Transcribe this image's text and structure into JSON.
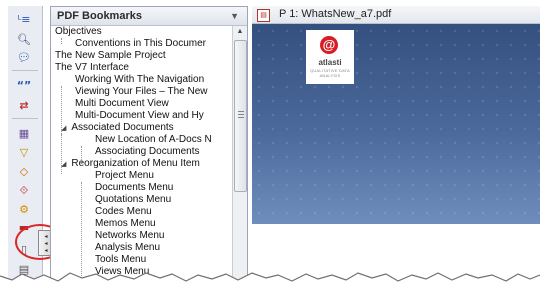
{
  "bookmarks_panel": {
    "title": "PDF Bookmarks",
    "items": [
      {
        "label": "Objectives",
        "level": 0,
        "expander": false
      },
      {
        "label": "Conventions in This Documer",
        "level": 1,
        "expander": false
      },
      {
        "label": "The New Sample Project",
        "level": 0,
        "expander": false
      },
      {
        "label": "The V7 Interface",
        "level": 0,
        "expander": false
      },
      {
        "label": "Working With The Navigation",
        "level": 1,
        "expander": false
      },
      {
        "label": "Viewing Your Files – The New",
        "level": 1,
        "expander": false
      },
      {
        "label": "Multi Document View",
        "level": 1,
        "expander": false
      },
      {
        "label": "Multi-Document View and Hy",
        "level": 1,
        "expander": false
      },
      {
        "label": "Associated Documents",
        "level": 1,
        "expander": true
      },
      {
        "label": "New Location of A-Docs N",
        "level": 2,
        "expander": false
      },
      {
        "label": "Associating Documents",
        "level": 2,
        "expander": false
      },
      {
        "label": "Reorganization of Menu Item",
        "level": 1,
        "expander": true
      },
      {
        "label": "Project Menu",
        "level": 2,
        "expander": false
      },
      {
        "label": "Documents Menu",
        "level": 2,
        "expander": false
      },
      {
        "label": "Quotations Menu",
        "level": 2,
        "expander": false
      },
      {
        "label": "Codes Menu",
        "level": 2,
        "expander": false
      },
      {
        "label": "Memos Menu",
        "level": 2,
        "expander": false
      },
      {
        "label": "Networks Menu",
        "level": 2,
        "expander": false
      },
      {
        "label": "Analysis Menu",
        "level": 2,
        "expander": false
      },
      {
        "label": "Tools Menu",
        "level": 2,
        "expander": false
      },
      {
        "label": "Views Menu",
        "level": 2,
        "expander": false
      }
    ]
  },
  "document": {
    "tab_title": "P 1: WhatsNew_a7.pdf",
    "logo": {
      "mark": "@",
      "name": "atlasti",
      "tagline": "QUALITATIVE DATA ANALYSIS"
    }
  },
  "toolbar": {
    "icons": [
      "text-icon",
      "search-icon",
      "comment-icon",
      "quote-icon",
      "quote-swap-icon",
      "table-icon",
      "funnel-icon",
      "node-icon",
      "link-icon",
      "gear-icon",
      "book-icon",
      "pane-icon",
      "page-icon"
    ]
  },
  "pane_toggle": {
    "arrows": "◂◂◂"
  },
  "colors": {
    "accent_red": "#d9282b",
    "doc_background": "#34507f",
    "panel_border": "#9aa6b5"
  }
}
